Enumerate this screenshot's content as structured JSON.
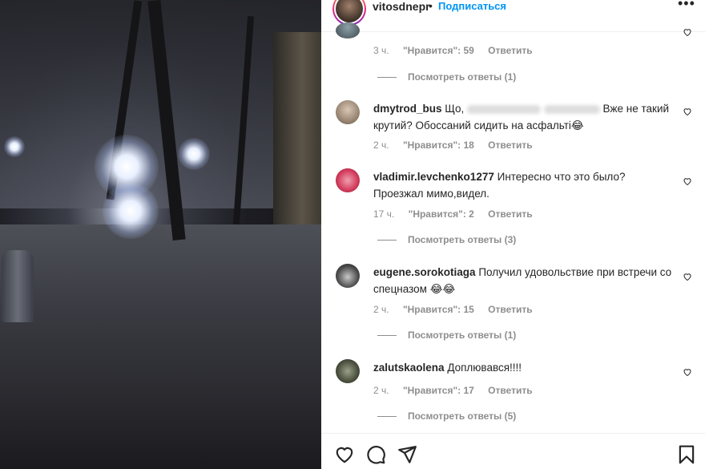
{
  "header": {
    "username": "vitosdnepr",
    "separator": "•",
    "follow_label": "Подписаться",
    "more_label": "•••"
  },
  "comments": [
    {
      "time": "3 ч.",
      "likes": "\"Нравится\": 59",
      "reply": "Ответить",
      "view_replies": "Посмотреть ответы (1)"
    },
    {
      "user": "dmytrod_bus",
      "text_a": "Що,",
      "text_b": "Вже не такий крутий? Обоссаний сидить на асфальті😂",
      "time": "2 ч.",
      "likes": "\"Нравится\": 18",
      "reply": "Ответить"
    },
    {
      "user": "vladimir.levchenko1277",
      "text": "Интересно что это было? Проезжал мимо,видел.",
      "time": "17 ч.",
      "likes": "\"Нравится\": 2",
      "reply": "Ответить",
      "view_replies": "Посмотреть ответы (3)"
    },
    {
      "user": "eugene.sorokotiaga",
      "text": "Получил удовольствие при встречи со спецназом 😂😂",
      "time": "2 ч.",
      "likes": "\"Нравится\": 15",
      "reply": "Ответить",
      "view_replies": "Посмотреть ответы (1)"
    },
    {
      "user": "zalutskaolena",
      "text": "Доплювався!!!!",
      "time": "2 ч.",
      "likes": "\"Нравится\": 17",
      "reply": "Ответить",
      "view_replies": "Посмотреть ответы (5)"
    }
  ],
  "icons": {
    "like": "heart-icon",
    "comment": "comment-icon",
    "share": "share-icon",
    "save": "bookmark-icon"
  },
  "colors": {
    "accent": "#0095f6",
    "muted": "#8e8e8e",
    "text": "#262626"
  }
}
